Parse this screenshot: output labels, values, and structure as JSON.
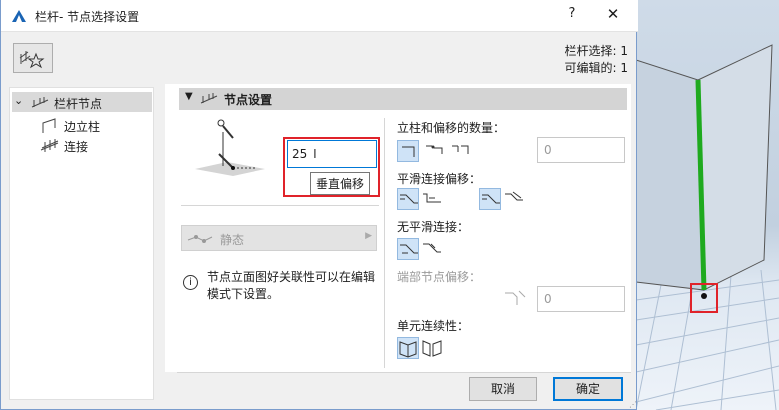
{
  "window": {
    "title": "栏杆- 节点选择设置",
    "help": "?",
    "close": "✕"
  },
  "selection_info": {
    "selected": "栏杆选择: 1",
    "editable": "可编辑的: 1"
  },
  "tree": {
    "items": [
      {
        "label": "栏杆节点",
        "icon": "railing-icon",
        "expanded": true
      },
      {
        "label": "边立柱",
        "icon": "post-icon"
      },
      {
        "label": "连接",
        "icon": "connection-icon"
      }
    ]
  },
  "panel": {
    "title": "节点设置",
    "offset_input": {
      "value": "25",
      "tooltip": "垂直偏移"
    },
    "static_dropdown": {
      "value": "静态"
    },
    "info_note": "节点立面图好关联性可以在编辑模式下设置。",
    "posts_offset": {
      "label": "立柱和偏移的数量：",
      "value": "0"
    },
    "smooth_offset": {
      "label": "平滑连接偏移："
    },
    "no_smooth": {
      "label": "无平滑连接："
    },
    "end_offset": {
      "label": "端部节点偏移：",
      "value": "0"
    },
    "segment_continuity": {
      "label": "单元连续性："
    }
  },
  "buttons": {
    "cancel": "取消",
    "ok": "确定"
  },
  "colors": {
    "accent": "#0078d7",
    "highlight_box": "#e0232a",
    "rail_green": "#1faa1f"
  }
}
